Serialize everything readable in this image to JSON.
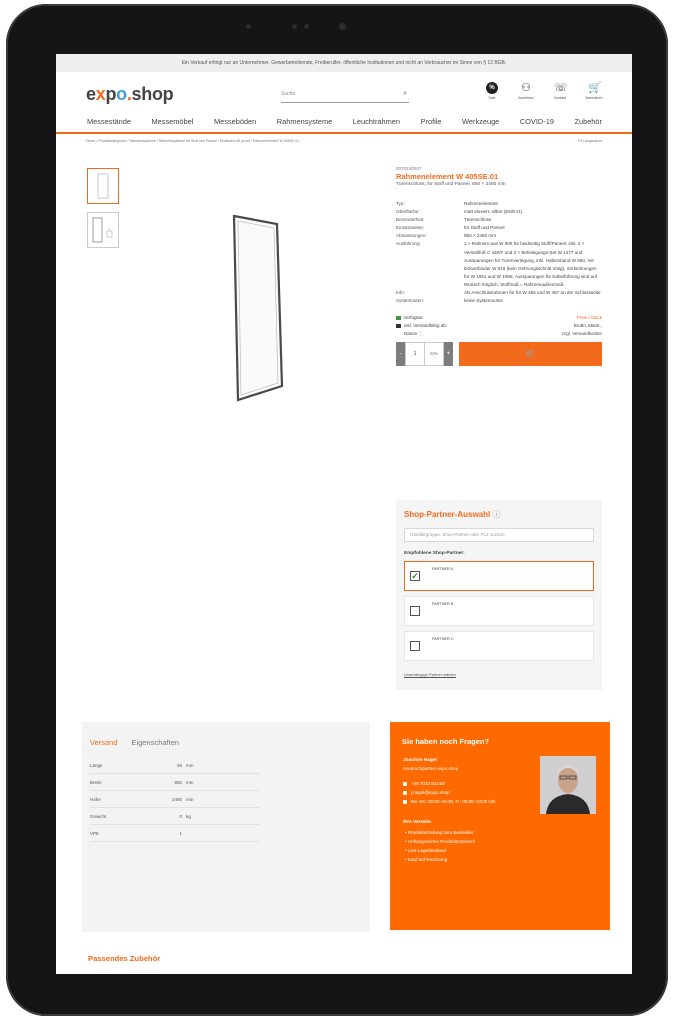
{
  "notice": "Ein Verkauf erfolgt nur an Unternehmer, Gewerbetreibende, Freiberufler, öffentliche Institutionen und nicht an Verbraucher im Sinne von § 13 BGB.",
  "logo": {
    "e": "e",
    "x": "x",
    "p": "p",
    "o": "o",
    "dot": ".",
    "shop": "shop"
  },
  "search": {
    "placeholder": "Suche"
  },
  "header_icons": [
    {
      "name": "sale-icon",
      "glyph": "%",
      "label": "Sale"
    },
    {
      "name": "user-icon",
      "glyph": "⚇",
      "label": "Anmelden"
    },
    {
      "name": "phone-icon",
      "glyph": "☏",
      "label": "Kontakt"
    },
    {
      "name": "cart-icon",
      "glyph": "🛒",
      "label": "Warenkorb"
    }
  ],
  "nav": [
    "Messestände",
    "Messemöbel",
    "Messeböden",
    "Rahmensysteme",
    "Leuchtrahmen",
    "Profile",
    "Werkzeuge",
    "COVID-19",
    "Zubehör"
  ],
  "breadcrumb": "Home / Produktkategorien / Rahmensysteme / Rahmensysteme für Stoff und Paneel / Stoffwand 65 (oval) / Rahmenelement W 405SE.01",
  "breadcrumb_right": "Fit Langansicht",
  "product": {
    "sku": "0070240S07",
    "title": "Rahmenelement W 405SE.01",
    "subtitle": "Türenschloss, für Stoff und Paneel, 850 × 2480 mm",
    "specs": [
      {
        "k": "Typ:",
        "v": "Rahmenelement"
      },
      {
        "k": "Oberfläche:",
        "v": "matt eloxiert, silber (E6/EV1)"
      },
      {
        "k": "Besonderheit:",
        "v": "Türenschloss"
      },
      {
        "k": "Einsetzweise:",
        "v": "für Stoff und Paneel"
      },
      {
        "k": "Abmessungen:",
        "v": "850 × 2480 mm"
      },
      {
        "k": "Ausführung:",
        "v": "1 × Rahmen aus W 909 für beidseitig Stoff/Paneel, inkl. 2 × Verstellfuß C 440/F und 3 × Befestigungs-Set W 1477 und Aussparungen für Türenverlegung, inkl. Halbenband W 860, mit Eckverbinder W 916 (kein Gehrungsschnitt nötig), mit Bohrungen für W 1951 und W 1955, Aussparungen für Kabelführung sind auf Wunsch möglich, Stoffmaß = Rahmenaußenmaß"
      },
      {
        "k": "Info:",
        "v": "Als Anschlussrahmen für für W 455 und W 457 an der Schlossseite"
      },
      {
        "k": "Systemnuten:",
        "v": "keine Systemnuten"
      }
    ],
    "availability": "Verfügbar",
    "availability_right": "Preis / Stück",
    "shipping": "inkl. Versandfähig ab:",
    "shipping_right": "Brutto, MwSt.,",
    "date_label": "Datum",
    "date_right": "zzgl. Versandkosten",
    "qty": "1",
    "unit": "STK",
    "minus": "-",
    "plus": "+",
    "cart_glyph": "🛒"
  },
  "partner": {
    "title": "Shop-Partner-Auswahl",
    "input_placeholder": "Händlergruppe, Shop-Partner oder PLZ suchen",
    "recommended": "Empfohlene Shop-Partner:",
    "items": [
      {
        "name": "PARTNER A",
        "selected": true
      },
      {
        "name": "PARTNER B",
        "selected": false
      },
      {
        "name": "PARTNER C",
        "selected": false
      }
    ],
    "link": "Unabhängige Partner wählen"
  },
  "tabs": {
    "active": "Versand",
    "inactive": "Eigenschaften"
  },
  "shipping_props": [
    {
      "k": "Länge",
      "v": "46",
      "u": "mm"
    },
    {
      "k": "Breite",
      "v": "850",
      "u": "mm"
    },
    {
      "k": "Höhe",
      "v": "2480",
      "u": "mm"
    },
    {
      "k": "Gewicht",
      "v": "0",
      "u": "kg"
    },
    {
      "k": "VPE",
      "v": "1",
      "u": ""
    }
  ],
  "contact": {
    "title": "Sie haben noch Fragen?",
    "name": "Joachim Nagel",
    "role": "Ansprechpartner expo shop",
    "phone": "+49 7032 82148/",
    "email": "j.nagel@expo.shop",
    "hours": "Mo–Do: 08:00–16:30, Fr: 08:00–13:00 Uhr",
    "benefits_title": "Ihre Vorteile:",
    "benefits": [
      "Produktschulung zum Bestseller",
      "Umfangreiches Produktsortiment",
      "Live-Lagerbestand",
      "Kauf auf Rechnung"
    ]
  },
  "accessories_title": "Passendes Zubehör",
  "colors": {
    "accent": "#f26a1b",
    "contact_bg": "#ff6a00",
    "frame": "#151515"
  }
}
